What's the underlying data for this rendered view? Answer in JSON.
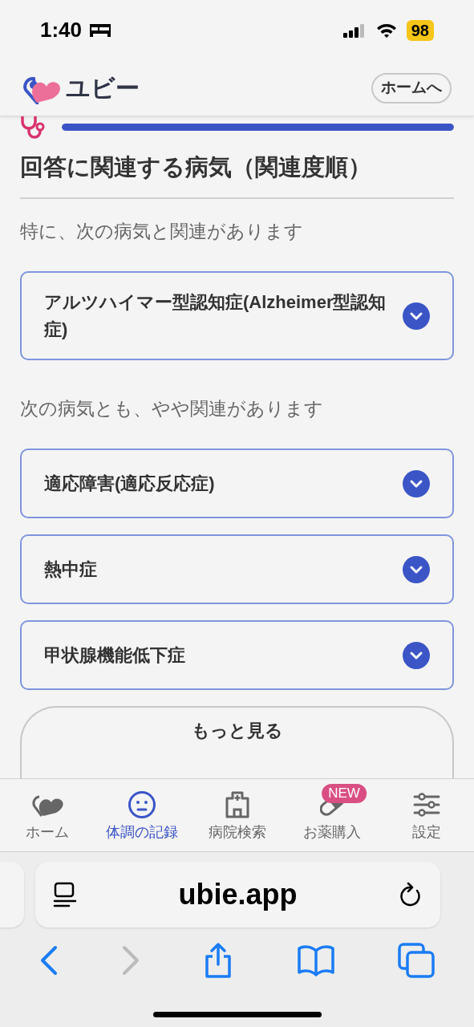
{
  "status_bar": {
    "time": "1:40",
    "battery": "98"
  },
  "header": {
    "logo_text": "ユビー",
    "home_button": "ホームへ"
  },
  "progress": {
    "level": 1
  },
  "section_title": "回答に関連する病気（関連度順）",
  "groups": [
    {
      "intro": "特に、次の病気と関連があります",
      "diseases": [
        {
          "name": "アルツハイマー型認知症(Alzheimer型認知症)"
        }
      ]
    },
    {
      "intro": "次の病気とも、やや関連があります",
      "diseases": [
        {
          "name": "適応障害(適応反応症)"
        },
        {
          "name": "熱中症"
        },
        {
          "name": "甲状腺機能低下症"
        }
      ]
    }
  ],
  "more_button": "もっと見る",
  "tab_bar": [
    {
      "kind": "home",
      "label": "ホーム",
      "selected": false
    },
    {
      "kind": "record",
      "label": "体調の記録",
      "selected": true
    },
    {
      "kind": "hospital",
      "label": "病院検索",
      "selected": false
    },
    {
      "kind": "medicine",
      "label": "お薬購入",
      "selected": false,
      "badge": "NEW"
    },
    {
      "kind": "settings",
      "label": "設定",
      "selected": false
    }
  ],
  "browser": {
    "url": "ubie.app",
    "back_disabled": false,
    "forward_disabled": true
  }
}
